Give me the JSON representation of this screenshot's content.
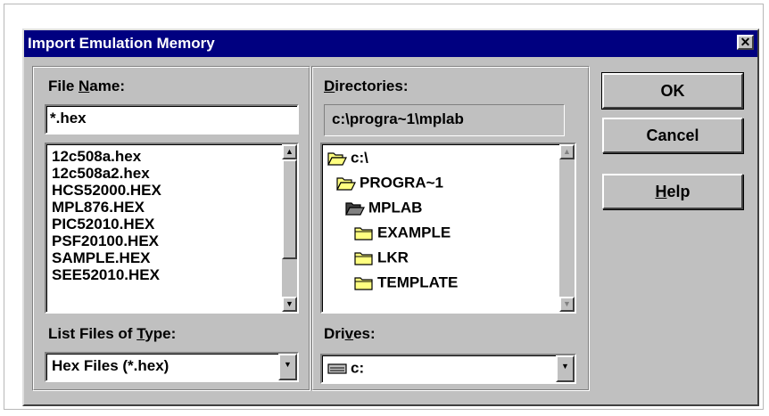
{
  "dialog": {
    "title": "Import Emulation Memory",
    "close_glyph": "✕"
  },
  "file_name": {
    "label_pre": "File ",
    "label_ul": "N",
    "label_post": "ame:",
    "value": "*.hex"
  },
  "files": [
    "12c508a.hex",
    "12c508a2.hex",
    "HCS52000.HEX",
    "MPL876.HEX",
    "PIC52010.HEX",
    "PSF20100.HEX",
    "SAMPLE.HEX",
    "SEE52010.HEX"
  ],
  "file_type": {
    "label_pre": "List Files of ",
    "label_ul": "T",
    "label_post": "ype:",
    "value": "Hex Files (*.hex)"
  },
  "directories": {
    "label_pre": "",
    "label_ul": "D",
    "label_post": "irectories:",
    "current_path": "c:\\progra~1\\mplab",
    "items": [
      {
        "label": "c:\\",
        "icon": "open-folder-icon"
      },
      {
        "label": "PROGRA~1",
        "icon": "open-folder-icon"
      },
      {
        "label": "MPLAB",
        "icon": "open-folder-selected-icon"
      },
      {
        "label": "EXAMPLE",
        "icon": "folder-icon"
      },
      {
        "label": "LKR",
        "icon": "folder-icon"
      },
      {
        "label": "TEMPLATE",
        "icon": "folder-icon"
      }
    ]
  },
  "drives": {
    "label_pre": "Dri",
    "label_ul": "v",
    "label_post": "es:",
    "value": "c:",
    "icon": "drive-icon"
  },
  "buttons": {
    "ok": "OK",
    "cancel": "Cancel",
    "help_ul": "H",
    "help_post": "elp"
  },
  "scroll_glyphs": {
    "up": "▲",
    "down": "▼"
  },
  "colors": {
    "title_bar": "#000080",
    "face": "#c0c0c0",
    "folder": "#ffff80"
  }
}
